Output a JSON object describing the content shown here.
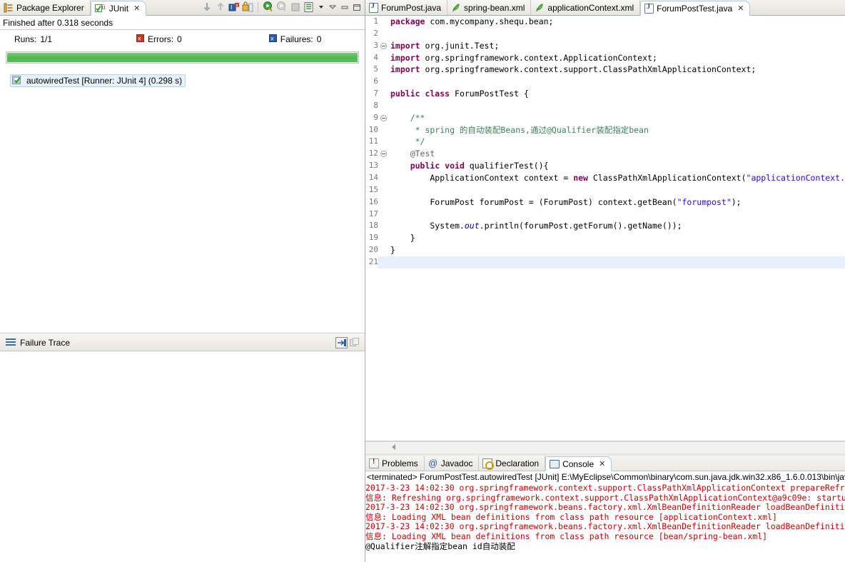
{
  "left_view": {
    "tabs": [
      {
        "label": "Package Explorer",
        "icon": "package-explorer-icon",
        "active": false,
        "closable": false
      },
      {
        "label": "JUnit",
        "icon": "junit-icon",
        "active": true,
        "closable": true
      }
    ],
    "toolbar_icons": [
      "next-failure-icon",
      "previous-failure-icon",
      "show-failures-only-icon",
      "lock-scroll-icon",
      "rerun-test-icon",
      "rerun-test-failures-icon",
      "stop-icon",
      "test-run-history-icon",
      "view-menu-chevron-icon",
      "minimize-icon",
      "maximize-icon"
    ],
    "status_text": "Finished after 0.318 seconds",
    "counters": {
      "runs_label": "Runs:",
      "runs_value": "1/1",
      "errors_label": "Errors:",
      "errors_value": "0",
      "errors_icon": "error-marker-icon",
      "failures_label": "Failures:",
      "failures_value": "0",
      "failures_icon": "failure-marker-icon"
    },
    "progress": {
      "percent": 100,
      "color": "#4eb84e"
    },
    "tree": [
      {
        "label": "autowiredTest [Runner: JUnit 4] (0.298 s)",
        "icon": "test-passed-icon",
        "selected": true
      }
    ],
    "failure_trace": {
      "title": "Failure Trace",
      "icon": "failure-trace-icon",
      "buttons": [
        "compare-result-icon",
        "copy-trace-icon"
      ],
      "content": ""
    }
  },
  "editor": {
    "tabs": [
      {
        "label": "ForumPost.java",
        "icon": "java-file-icon",
        "active": false,
        "closable": false
      },
      {
        "label": "spring-bean.xml",
        "icon": "xml-file-icon",
        "active": false,
        "closable": false
      },
      {
        "label": "applicationContext.xml",
        "icon": "xml-file-icon",
        "active": false,
        "closable": false
      },
      {
        "label": "ForumPostTest.java",
        "icon": "java-file-icon",
        "active": true,
        "closable": true
      }
    ],
    "gutter_annotation": "occurrence-marker",
    "scrollbar": {
      "arrow_icon": "scroll-left-arrow-icon"
    },
    "highlighted_line": 21,
    "lines": [
      {
        "n": 1,
        "fold": false,
        "tokens": [
          {
            "t": "kw",
            "v": "package"
          },
          {
            "t": "plain",
            "v": " com.mycompany.shequ.bean;"
          }
        ]
      },
      {
        "n": 2,
        "fold": false,
        "tokens": []
      },
      {
        "n": 3,
        "fold": true,
        "tokens": [
          {
            "t": "kw",
            "v": "import"
          },
          {
            "t": "plain",
            "v": " org.junit.Test;"
          }
        ]
      },
      {
        "n": 4,
        "fold": false,
        "tokens": [
          {
            "t": "kw",
            "v": "import"
          },
          {
            "t": "plain",
            "v": " org.springframework.context.ApplicationContext;"
          }
        ]
      },
      {
        "n": 5,
        "fold": false,
        "tokens": [
          {
            "t": "kw",
            "v": "import"
          },
          {
            "t": "plain",
            "v": " org.springframework.context.support.ClassPathXmlApplicationContext;"
          }
        ]
      },
      {
        "n": 6,
        "fold": false,
        "tokens": []
      },
      {
        "n": 7,
        "fold": false,
        "tokens": [
          {
            "t": "kw",
            "v": "public class"
          },
          {
            "t": "plain",
            "v": " ForumPostTest {"
          }
        ]
      },
      {
        "n": 8,
        "fold": false,
        "tokens": []
      },
      {
        "n": 9,
        "fold": true,
        "tokens": [
          {
            "t": "cmt",
            "v": "    /**"
          }
        ]
      },
      {
        "n": 10,
        "fold": false,
        "tokens": [
          {
            "t": "cmt",
            "v": "     * spring 的自动装配Beans,通过@Qualifier装配指定bean"
          }
        ]
      },
      {
        "n": 11,
        "fold": false,
        "tokens": [
          {
            "t": "cmt",
            "v": "     */"
          }
        ]
      },
      {
        "n": 12,
        "fold": true,
        "tokens": [
          {
            "t": "ann",
            "v": "    @Test"
          }
        ]
      },
      {
        "n": 13,
        "fold": false,
        "tokens": [
          {
            "t": "plain",
            "v": "    "
          },
          {
            "t": "kw",
            "v": "public void"
          },
          {
            "t": "plain",
            "v": " qualifierTest(){"
          }
        ]
      },
      {
        "n": 14,
        "fold": false,
        "tokens": [
          {
            "t": "plain",
            "v": "        ApplicationContext context = "
          },
          {
            "t": "kw",
            "v": "new"
          },
          {
            "t": "plain",
            "v": " ClassPathXmlApplicationContext("
          },
          {
            "t": "str",
            "v": "\"applicationContext.xml\""
          },
          {
            "t": "plain",
            "v": ");"
          }
        ]
      },
      {
        "n": 15,
        "fold": false,
        "tokens": []
      },
      {
        "n": 16,
        "fold": false,
        "tokens": [
          {
            "t": "plain",
            "v": "        ForumPost forumPost = (ForumPost) context.getBean("
          },
          {
            "t": "str",
            "v": "\"forumpost\""
          },
          {
            "t": "plain",
            "v": ");"
          }
        ]
      },
      {
        "n": 17,
        "fold": false,
        "tokens": []
      },
      {
        "n": 18,
        "fold": false,
        "tokens": [
          {
            "t": "plain",
            "v": "        System."
          },
          {
            "t": "fld",
            "v": "out"
          },
          {
            "t": "plain",
            "v": ".println(forumPost.getForum().getName());"
          }
        ]
      },
      {
        "n": 19,
        "fold": false,
        "tokens": [
          {
            "t": "plain",
            "v": "    }"
          }
        ]
      },
      {
        "n": 20,
        "fold": false,
        "tokens": [
          {
            "t": "plain",
            "v": "}"
          }
        ]
      },
      {
        "n": 21,
        "fold": false,
        "tokens": []
      }
    ]
  },
  "bottom_panel": {
    "tabs": [
      {
        "label": "Problems",
        "icon": "problems-icon",
        "active": false,
        "closable": false
      },
      {
        "label": "Javadoc",
        "icon": "javadoc-icon",
        "active": false,
        "closable": false
      },
      {
        "label": "Declaration",
        "icon": "declaration-icon",
        "active": false,
        "closable": false
      },
      {
        "label": "Console",
        "icon": "console-icon",
        "active": true,
        "closable": true
      }
    ],
    "console": {
      "header": "<terminated> ForumPostTest.autowiredTest [JUnit] E:\\MyEclipse\\Common\\binary\\com.sun.java.jdk.win32.x86_1.6.0.013\\bin\\javaw",
      "lines": [
        {
          "color": "red",
          "text": "2017-3-23 14:02:30 org.springframework.context.support.ClassPathXmlApplicationContext prepareRefresh"
        },
        {
          "color": "red",
          "text": "信息: Refreshing org.springframework.context.support.ClassPathXmlApplicationContext@a9c09e: startup date [Th"
        },
        {
          "color": "red",
          "text": "2017-3-23 14:02:30 org.springframework.beans.factory.xml.XmlBeanDefinitionReader loadBeanDefinitions"
        },
        {
          "color": "red",
          "text": "信息: Loading XML bean definitions from class path resource [applicationContext.xml]"
        },
        {
          "color": "red",
          "text": "2017-3-23 14:02:30 org.springframework.beans.factory.xml.XmlBeanDefinitionReader loadBeanDefinitions"
        },
        {
          "color": "red",
          "text": "信息: Loading XML bean definitions from class path resource [bean/spring-bean.xml]"
        },
        {
          "color": "black",
          "text": "@Qualifier注解指定bean id自动装配"
        }
      ]
    }
  }
}
